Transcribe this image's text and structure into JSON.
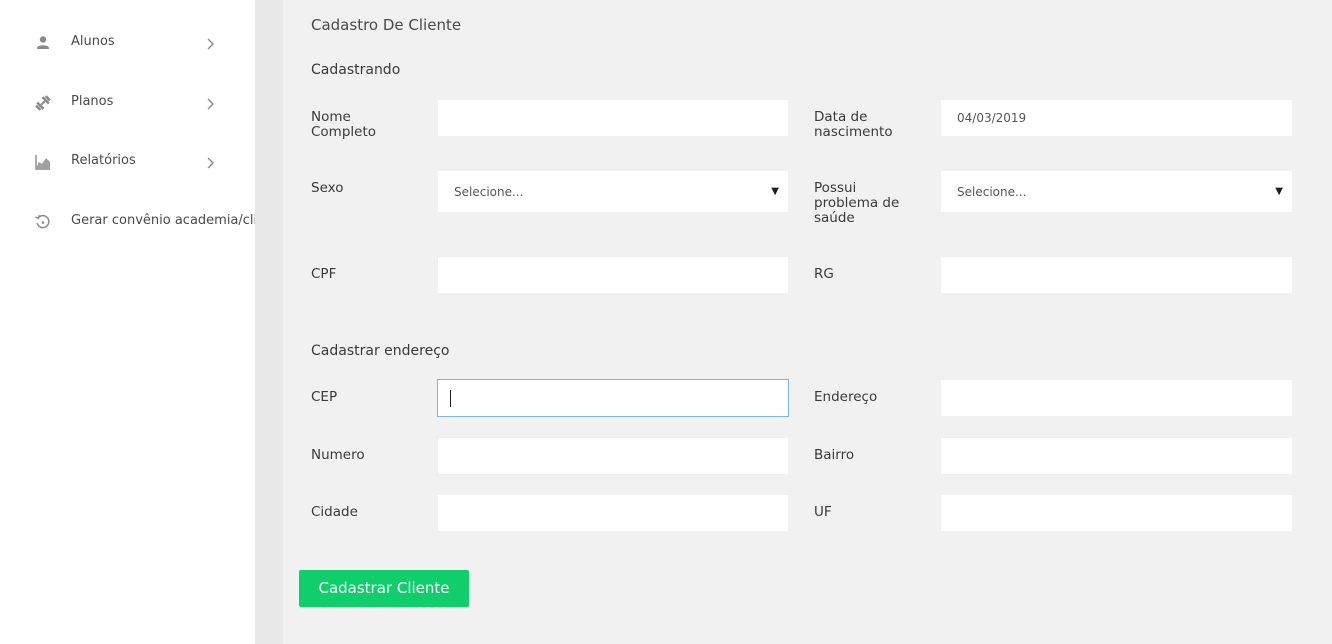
{
  "sidebar": {
    "items": [
      {
        "label": "Alunos",
        "icon": "user-icon",
        "has_chevron": true
      },
      {
        "label": "Planos",
        "icon": "dumbbell-icon",
        "has_chevron": true
      },
      {
        "label": "Relatórios",
        "icon": "chart-icon",
        "has_chevron": true
      },
      {
        "label": "Gerar convênio academia/clie",
        "icon": "history-icon",
        "has_chevron": false
      }
    ]
  },
  "page": {
    "title": "Cadastro De Cliente",
    "section_personal": "Cadastrando",
    "section_address": "Cadastrar endereço"
  },
  "form": {
    "nome": {
      "label_1": "Nome",
      "label_2": "Completo",
      "value": ""
    },
    "nascimento": {
      "label_1": "Data de",
      "label_2": "nascimento",
      "value": "04/03/2019"
    },
    "sexo": {
      "label": "Sexo",
      "value": "Selecione..."
    },
    "saude": {
      "label_1": "Possui",
      "label_2": "problema de",
      "label_3": "saúde",
      "value": "Selecione..."
    },
    "cpf": {
      "label": "CPF",
      "value": ""
    },
    "rg": {
      "label": "RG",
      "value": ""
    },
    "cep": {
      "label": "CEP",
      "value": ""
    },
    "endereco": {
      "label": "Endereço",
      "value": ""
    },
    "numero": {
      "label": "Numero",
      "value": ""
    },
    "bairro": {
      "label": "Bairro",
      "value": ""
    },
    "cidade": {
      "label": "Cidade",
      "value": ""
    },
    "uf": {
      "label": "UF",
      "value": ""
    }
  },
  "actions": {
    "submit_label": "Cadastrar Cliente"
  },
  "colors": {
    "accent": "#0fce6b",
    "focus_border": "#7fb4e0"
  }
}
